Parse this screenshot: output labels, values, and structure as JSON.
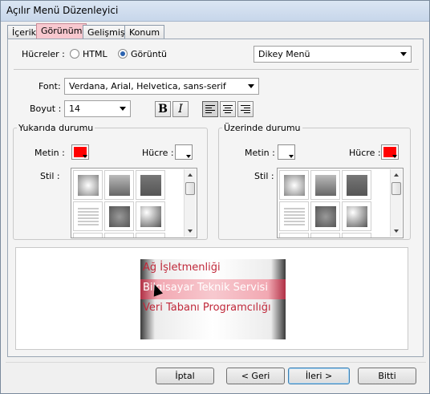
{
  "window": {
    "title": "Açılır Menü Düzenleyici"
  },
  "tabs": [
    {
      "label": "İçerik",
      "active": false
    },
    {
      "label": "Görünüm",
      "active": true
    },
    {
      "label": "Gelişmiş",
      "active": false
    },
    {
      "label": "Konum",
      "active": false
    }
  ],
  "cells": {
    "label": "Hücreler :",
    "option_html": "HTML",
    "option_image": "Görüntü",
    "selected": "Görüntü",
    "menu_type": "Dikey Menü"
  },
  "font": {
    "label": "Font:",
    "value": "Verdana, Arial, Helvetica, sans-serif",
    "size_label": "Boyut :",
    "size_value": "14",
    "bold": "B",
    "italic": "I",
    "alignment": "left"
  },
  "normal_state": {
    "legend": "Yukarıda durumu",
    "text_label": "Metin :",
    "text_color": "#ff0000",
    "cell_label": "Hücre :",
    "cell_color": "#ffffff",
    "style_label": "Stil :"
  },
  "hover_state": {
    "legend": "Üzerinde durumu",
    "text_label": "Metin :",
    "text_color": "#ffffff",
    "cell_label": "Hücre :",
    "cell_color": "#ff0000",
    "style_label": "Stil :"
  },
  "preview": {
    "items": [
      "Ağ İşletmenliği",
      "Bilgisayar Teknik Servisi",
      "Veri Tabanı Programcılığı",
      ""
    ],
    "hover_index": 1
  },
  "buttons": {
    "cancel": "İptal",
    "back": "< Geri",
    "next": "İleri >",
    "finish": "Bitti"
  }
}
